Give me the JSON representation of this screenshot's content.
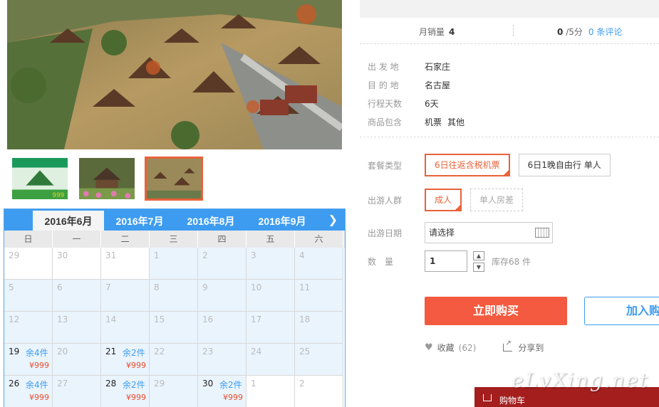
{
  "stats": {
    "sales_label": "月销量",
    "sales_value": "4",
    "score_value": "0",
    "score_suffix": "/5分",
    "reviews_link": "0 条评论"
  },
  "info": [
    {
      "label": "出 发 地",
      "value": "石家庄"
    },
    {
      "label": "目 的 地",
      "value": "名古屋"
    },
    {
      "label": "行程天数",
      "value": "6天"
    }
  ],
  "includes": {
    "label": "商品包含",
    "items": [
      "机票",
      "其他"
    ]
  },
  "package": {
    "label": "套餐类型",
    "options": [
      "6日往返含税机票",
      "6日1晚自由行 单人"
    ],
    "selected": 0
  },
  "group": {
    "label": "出游人群",
    "options": [
      "成人",
      "单人房差"
    ],
    "selected": 0
  },
  "date": {
    "label": "出游日期",
    "placeholder": "请选择"
  },
  "quantity": {
    "label": "数　量",
    "value": "1",
    "stock": "库存68 件"
  },
  "buttons": {
    "buy": "立即购买",
    "cart": "加入购物车"
  },
  "actions": {
    "favorite": "收藏",
    "favorite_count": "(62)",
    "share": "分享到"
  },
  "cartbar": {
    "label": "购物车"
  },
  "watermark": "eLvXing.net",
  "calendar": {
    "tabs": [
      "2016年6月",
      "2016年7月",
      "2016年8月",
      "2016年9月"
    ],
    "active_tab": 0,
    "weekdays": [
      "日",
      "一",
      "二",
      "三",
      "四",
      "五",
      "六"
    ],
    "days": [
      {
        "d": "29",
        "other": true
      },
      {
        "d": "30",
        "other": true
      },
      {
        "d": "31",
        "other": true
      },
      {
        "d": "1"
      },
      {
        "d": "2"
      },
      {
        "d": "3"
      },
      {
        "d": "4"
      },
      {
        "d": "5"
      },
      {
        "d": "6"
      },
      {
        "d": "7"
      },
      {
        "d": "8"
      },
      {
        "d": "9"
      },
      {
        "d": "10"
      },
      {
        "d": "11"
      },
      {
        "d": "12"
      },
      {
        "d": "13"
      },
      {
        "d": "14"
      },
      {
        "d": "15"
      },
      {
        "d": "16"
      },
      {
        "d": "17"
      },
      {
        "d": "18"
      },
      {
        "d": "19",
        "stock": "余4件",
        "price": "¥999"
      },
      {
        "d": "20"
      },
      {
        "d": "21",
        "stock": "余2件",
        "price": "¥999"
      },
      {
        "d": "22"
      },
      {
        "d": "23"
      },
      {
        "d": "24"
      },
      {
        "d": "25"
      },
      {
        "d": "26",
        "stock": "余4件",
        "price": "¥999"
      },
      {
        "d": "27"
      },
      {
        "d": "28",
        "stock": "余2件",
        "price": "¥999"
      },
      {
        "d": "29"
      },
      {
        "d": "30",
        "stock": "余2件",
        "price": "¥999"
      },
      {
        "d": "1",
        "other": true
      },
      {
        "d": "2",
        "other": true
      }
    ]
  },
  "thumb1_text": "999"
}
